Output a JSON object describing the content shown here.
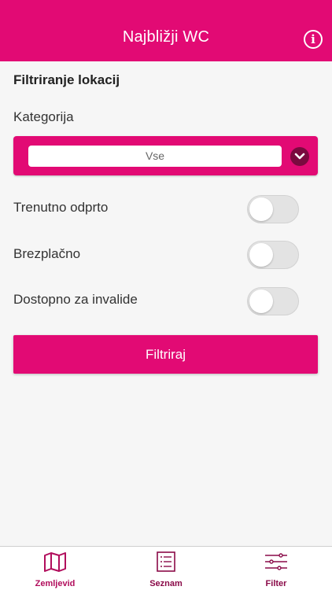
{
  "header": {
    "title": "Najbližji WC",
    "info_icon_glyph": "i",
    "color": "#e20a74"
  },
  "filter": {
    "section_title": "Filtriranje lokacij",
    "category_label": "Kategorija",
    "category_value": "Vse",
    "options": [
      {
        "label": "Trenutno odprto",
        "on": false
      },
      {
        "label": "Brezplačno",
        "on": false
      },
      {
        "label": "Dostopno za invalide",
        "on": false
      }
    ],
    "button_label": "Filtriraj"
  },
  "tabbar": {
    "tabs": [
      {
        "label": "Zemljevid",
        "icon": "map-icon",
        "active": true
      },
      {
        "label": "Seznam",
        "icon": "list-icon",
        "active": false
      },
      {
        "label": "Filter",
        "icon": "sliders-icon",
        "active": false
      }
    ],
    "active_color": "#b10d5c",
    "inactive_color": "#8a0a48"
  }
}
